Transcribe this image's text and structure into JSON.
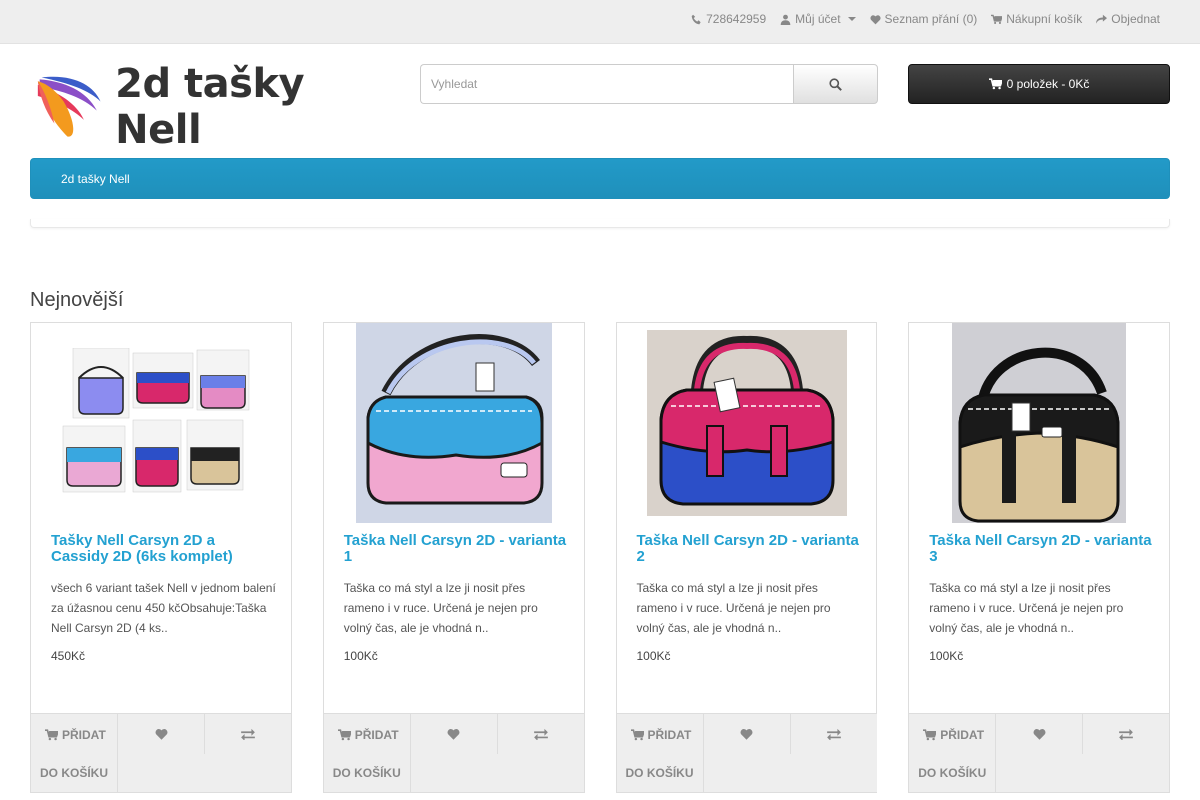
{
  "topnav": {
    "phone": "728642959",
    "account": "Můj účet",
    "wishlist": "Seznam přání (0)",
    "cart": "Nákupní košík",
    "checkout": "Objednat"
  },
  "header": {
    "logo_text": "2d tašky Nell",
    "search_placeholder": "Vyhledat",
    "cart_summary": "0 položek - 0Kč"
  },
  "menu": {
    "items": [
      "2d tašky Nell"
    ]
  },
  "section": {
    "title": "Nejnovější"
  },
  "buttons": {
    "add_line1": "PŘIDAT",
    "add_line2": "DO KOŠÍKU"
  },
  "colors": {
    "accent": "#229ac8",
    "link": "#23a1d1"
  },
  "products": [
    {
      "name": "Tašky Nell Carsyn 2D a Cassidy 2D (6ks komplet)",
      "description": "všech 6 variant tašek Nell v jednom balení za úžasnou cenu 450 kčObsahuje:Taška Nell Carsyn 2D (4 ks..",
      "price": "450Kč"
    },
    {
      "name": "Taška Nell Carsyn 2D - varianta 1",
      "description": "Taška co má styl a lze ji nosit přes rameno i v ruce. Určená je nejen pro volný čas, ale je vhodná n..",
      "price": "100Kč"
    },
    {
      "name": "Taška Nell Carsyn 2D - varianta 2",
      "description": "Taška co má styl a lze ji nosit přes rameno i v ruce. Určená je nejen pro volný čas, ale je vhodná n..",
      "price": "100Kč"
    },
    {
      "name": "Taška Nell Carsyn 2D - varianta 3",
      "description": "Taška co má styl a lze ji nosit přes rameno i v ruce. Určená je nejen pro volný čas, ale je vhodná n..",
      "price": "100Kč"
    }
  ]
}
